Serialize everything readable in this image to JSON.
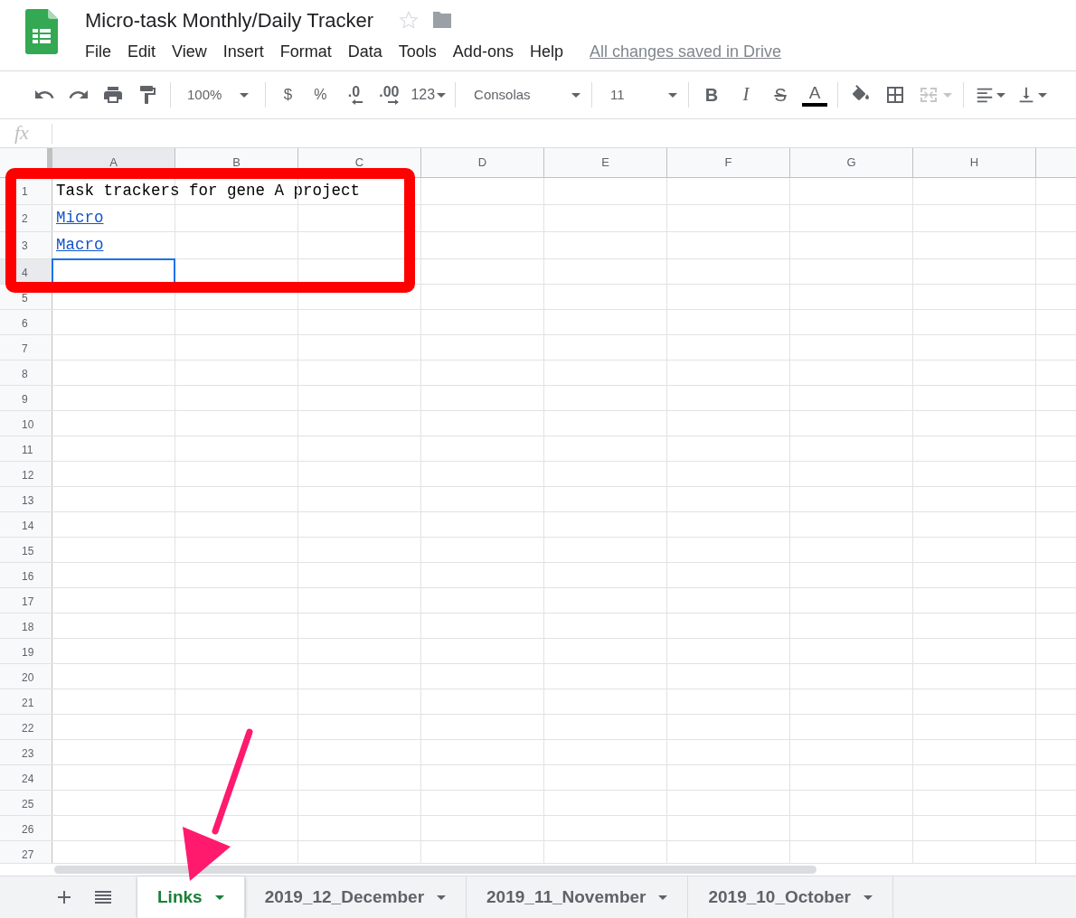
{
  "document": {
    "title": "Micro-task Monthly/Daily Tracker",
    "save_status": "All changes saved in Drive"
  },
  "menu": [
    "File",
    "Edit",
    "View",
    "Insert",
    "Format",
    "Data",
    "Tools",
    "Add-ons",
    "Help"
  ],
  "toolbar": {
    "zoom": "100%",
    "currency": "$",
    "percent": "%",
    "decrease_decimals": ".0",
    "increase_decimals": ".00",
    "more_formats": "123",
    "font": "Consolas",
    "font_size": "11",
    "bold": "B",
    "italic": "I",
    "strikethrough": "S",
    "text_color": "A"
  },
  "formula_bar": {
    "label": "fx"
  },
  "columns": [
    "A",
    "B",
    "C",
    "D",
    "E",
    "F",
    "G",
    "H"
  ],
  "rows": [
    {
      "number": "1",
      "cells": [
        {
          "kind": "text",
          "text": "Task trackers for gene A project",
          "selected": false
        }
      ]
    },
    {
      "number": "2",
      "cells": [
        {
          "kind": "link",
          "text": "Micro",
          "selected": false
        }
      ]
    },
    {
      "number": "3",
      "cells": [
        {
          "kind": "link",
          "text": "Macro",
          "selected": false
        }
      ]
    },
    {
      "number": "4",
      "cells": [
        {
          "kind": "empty",
          "selected": true
        }
      ]
    },
    {
      "number": "5"
    },
    {
      "number": "6"
    },
    {
      "number": "7"
    },
    {
      "number": "8"
    },
    {
      "number": "9"
    },
    {
      "number": "10"
    },
    {
      "number": "11"
    },
    {
      "number": "12"
    },
    {
      "number": "13"
    },
    {
      "number": "14"
    },
    {
      "number": "15"
    },
    {
      "number": "16"
    },
    {
      "number": "17"
    },
    {
      "number": "18"
    },
    {
      "number": "19"
    },
    {
      "number": "20"
    },
    {
      "number": "21"
    },
    {
      "number": "22"
    },
    {
      "number": "23"
    },
    {
      "number": "24"
    },
    {
      "number": "25"
    },
    {
      "number": "26"
    },
    {
      "number": "27"
    }
  ],
  "sheet_tabs": [
    {
      "label": "Links",
      "selected": true
    },
    {
      "label": "2019_12_December",
      "selected": false
    },
    {
      "label": "2019_11_November",
      "selected": false
    },
    {
      "label": "2019_10_October",
      "selected": false
    }
  ]
}
